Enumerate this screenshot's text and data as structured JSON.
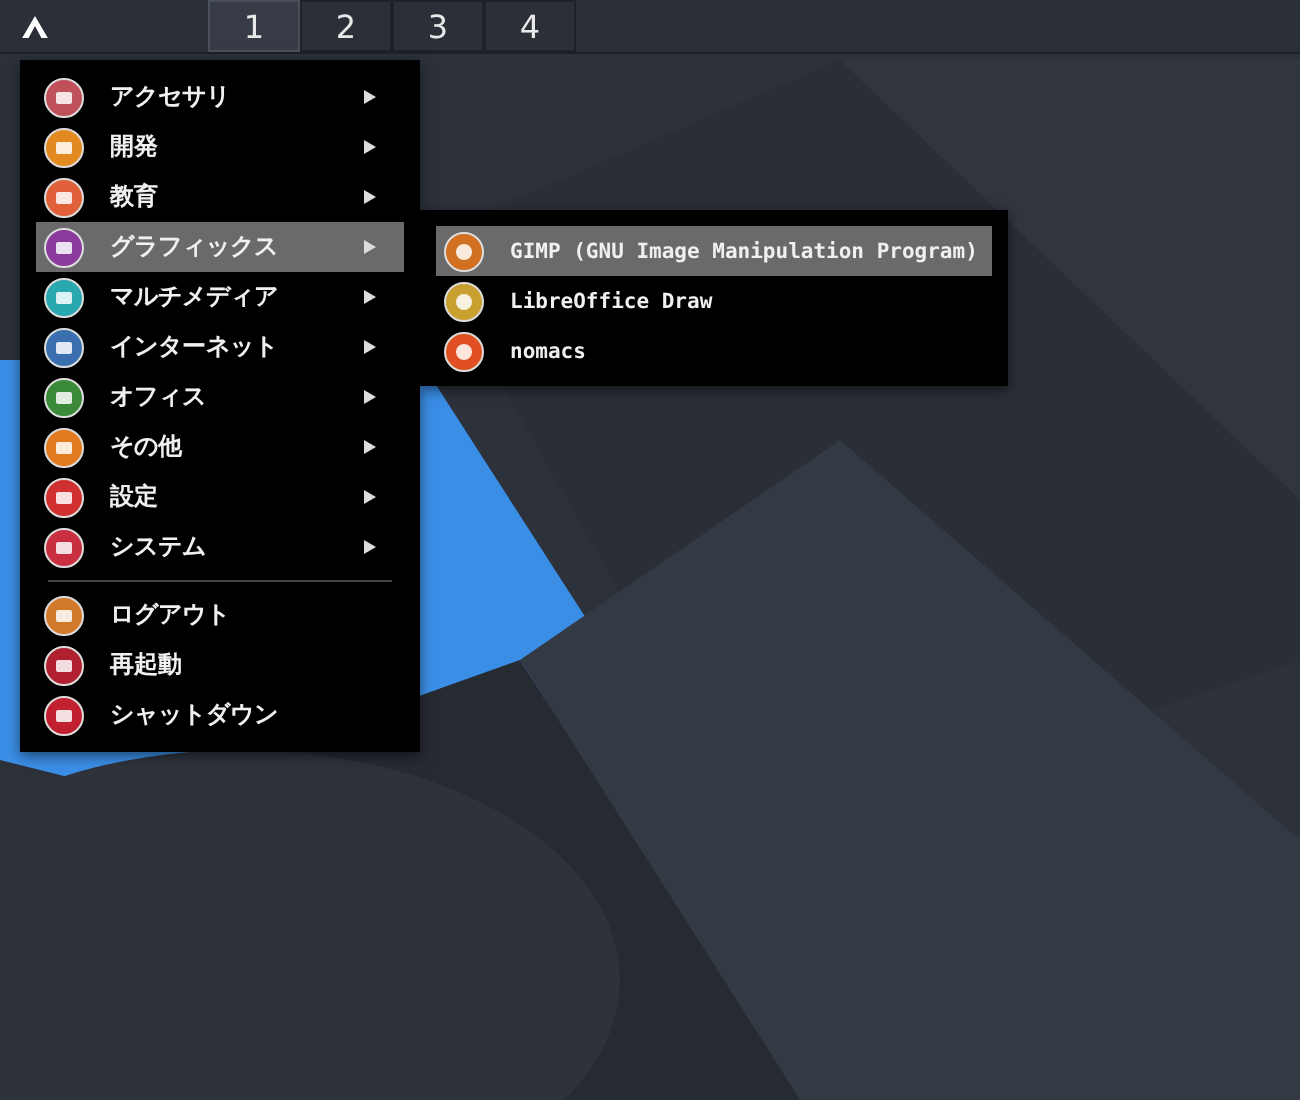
{
  "panel": {
    "workspaces": [
      {
        "label": "1",
        "selected": true
      },
      {
        "label": "2",
        "selected": false
      },
      {
        "label": "3",
        "selected": false
      },
      {
        "label": "4",
        "selected": false
      }
    ]
  },
  "menu": {
    "items": [
      {
        "label": "アクセサリ",
        "kind": "submenu",
        "color": "#c0505a",
        "selected": false
      },
      {
        "label": "開発",
        "kind": "submenu",
        "color": "#e08a20",
        "selected": false
      },
      {
        "label": "教育",
        "kind": "submenu",
        "color": "#e0603a",
        "selected": false
      },
      {
        "label": "グラフィックス",
        "kind": "submenu",
        "color": "#8a3a9a",
        "selected": true
      },
      {
        "label": "マルチメディア",
        "kind": "submenu",
        "color": "#2aa8b0",
        "selected": false
      },
      {
        "label": "インターネット",
        "kind": "submenu",
        "color": "#3a70b0",
        "selected": false
      },
      {
        "label": "オフィス",
        "kind": "submenu",
        "color": "#3a8a3a",
        "selected": false
      },
      {
        "label": "その他",
        "kind": "submenu",
        "color": "#e07a20",
        "selected": false
      },
      {
        "label": "設定",
        "kind": "submenu",
        "color": "#d03030",
        "selected": false
      },
      {
        "label": "システム",
        "kind": "submenu",
        "color": "#c83040",
        "selected": false
      },
      {
        "kind": "separator"
      },
      {
        "label": "ログアウト",
        "kind": "action",
        "color": "#d07a2a",
        "selected": false
      },
      {
        "label": "再起動",
        "kind": "action",
        "color": "#b02030",
        "selected": false
      },
      {
        "label": "シャットダウン",
        "kind": "action",
        "color": "#c02030",
        "selected": false
      }
    ]
  },
  "submenu": {
    "items": [
      {
        "label": "GIMP (GNU Image Manipulation Program)",
        "color": "#d07020",
        "selected": true
      },
      {
        "label": "LibreOffice Draw",
        "color": "#c8a030",
        "selected": false
      },
      {
        "label": "nomacs",
        "color": "#e05020",
        "selected": false
      }
    ]
  }
}
